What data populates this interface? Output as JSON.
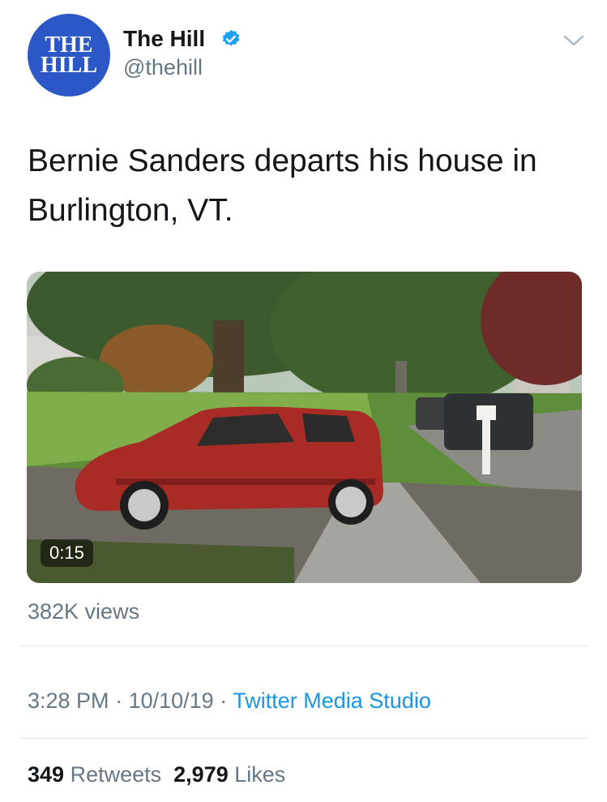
{
  "author": {
    "avatar_line1": "THE",
    "avatar_line2": "HILL",
    "name": "The Hill",
    "handle": "@thehill",
    "verified_icon": "verified-badge-icon",
    "menu_icon": "chevron-down-icon"
  },
  "tweet": {
    "text": "Bernie Sanders departs his house in Burlington, VT.",
    "video_duration": "0:15",
    "views": "382K views",
    "time": "3:28 PM",
    "date": "10/10/19",
    "separator": "·",
    "source": "Twitter Media Studio",
    "retweets_count": "349",
    "retweets_label": "Retweets",
    "likes_count": "2,979",
    "likes_label": "Likes"
  },
  "colors": {
    "avatar_bg": "#2b57c7",
    "verified": "#1da1f2",
    "link": "#1b95e0",
    "secondary_text": "#657786"
  }
}
